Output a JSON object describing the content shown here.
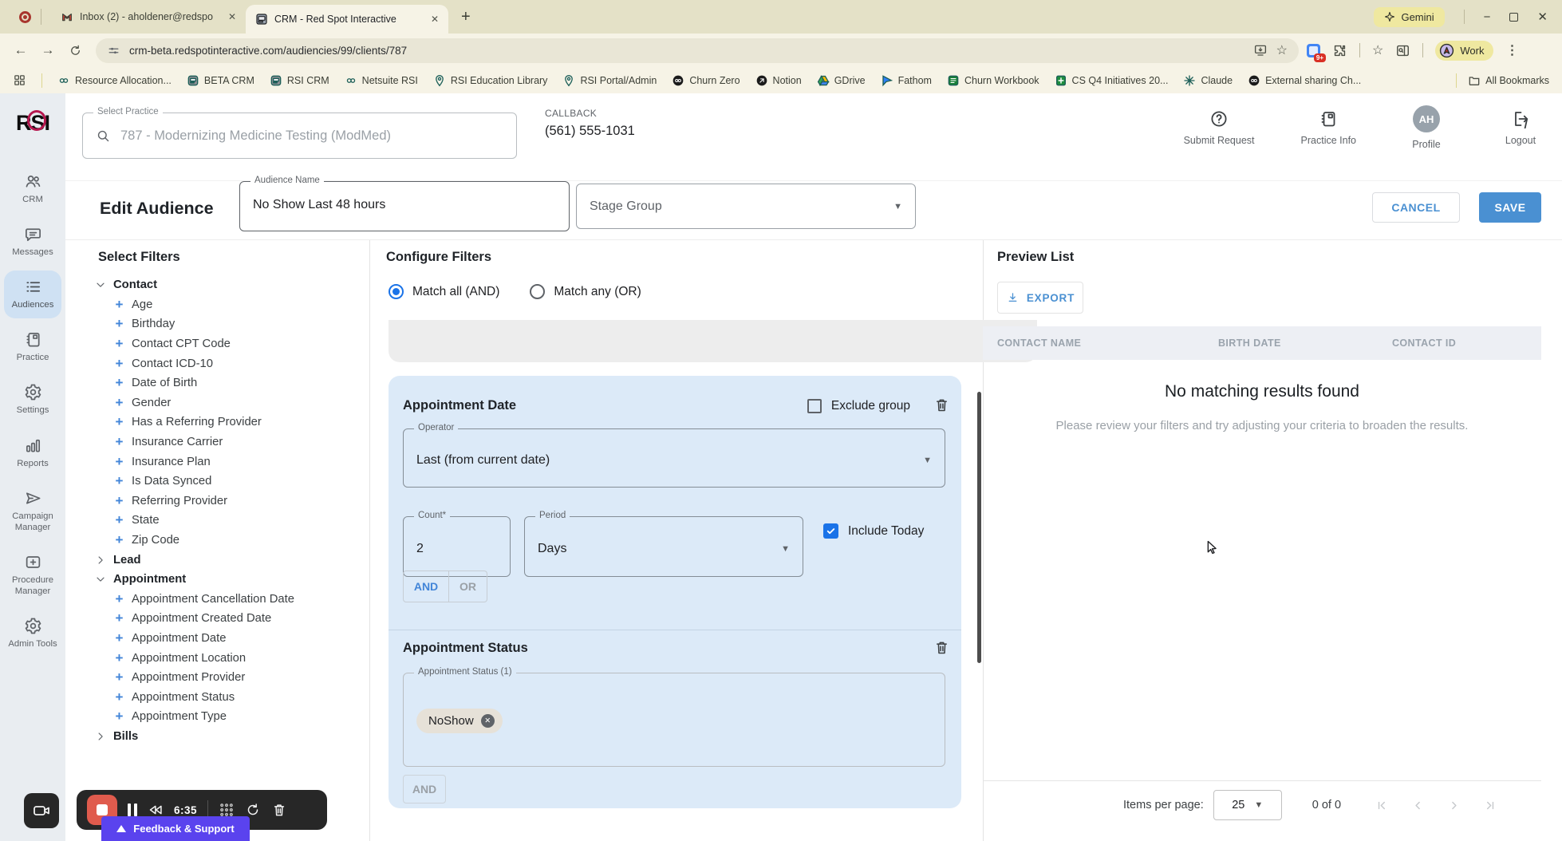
{
  "browser": {
    "tab1": "Inbox (2) - aholdener@redspo",
    "tab2": "CRM - Red Spot Interactive",
    "gemini": "Gemini",
    "url": "crm-beta.redspotinteractive.com/audiencies/99/clients/787",
    "ext_badge": "9+",
    "profile": "Work",
    "all_bookmarks": "All Bookmarks",
    "bookmarks": [
      {
        "label": "Resource Allocation...",
        "icon": "infinity-icon"
      },
      {
        "label": "BETA CRM",
        "icon": "rsi-icon"
      },
      {
        "label": "RSI CRM",
        "icon": "rsi-icon"
      },
      {
        "label": "Netsuite RSI",
        "icon": "infinity-icon"
      },
      {
        "label": "RSI Education Library",
        "icon": "map-pin-icon"
      },
      {
        "label": "RSI Portal/Admin",
        "icon": "map-pin-icon"
      },
      {
        "label": "Churn Zero",
        "icon": "infinity-badge-icon"
      },
      {
        "label": "Notion",
        "icon": "globe-arrow-icon"
      },
      {
        "label": "GDrive",
        "icon": "gdrive-icon"
      },
      {
        "label": "Fathom",
        "icon": "fathom-icon"
      },
      {
        "label": "Churn Workbook",
        "icon": "workbook-icon"
      },
      {
        "label": "CS Q4 Initiatives 20...",
        "icon": "sheets-plus-icon"
      },
      {
        "label": "Claude",
        "icon": "claude-icon"
      },
      {
        "label": "External sharing Ch...",
        "icon": "infinity-badge-icon"
      }
    ]
  },
  "header": {
    "logo": "RSI",
    "select_practice_label": "Select Practice",
    "select_practice_placeholder": "787 - Modernizing Medicine Testing (ModMed)",
    "callback_label": "CALLBACK",
    "callback_number": "(561) 555-1031",
    "actions": [
      {
        "label": "Submit Request",
        "icon": "question-circle-icon"
      },
      {
        "label": "Practice Info",
        "icon": "notebook-icon"
      },
      {
        "label": "Profile",
        "icon": "avatar",
        "initials": "AH"
      },
      {
        "label": "Logout",
        "icon": "logout-icon"
      }
    ]
  },
  "sidebar": {
    "items": [
      {
        "label": "CRM",
        "icon": "people-icon",
        "active": false
      },
      {
        "label": "Messages",
        "icon": "chat-icon",
        "active": false
      },
      {
        "label": "Audiences",
        "icon": "list-icon",
        "active": true
      },
      {
        "label": "Practice",
        "icon": "notebook-icon",
        "active": false
      },
      {
        "label": "Settings",
        "icon": "gear-icon",
        "active": false
      },
      {
        "label": "Reports",
        "icon": "bar-chart-icon",
        "active": false
      },
      {
        "label": "Campaign Manager",
        "icon": "send-icon",
        "active": false
      },
      {
        "label": "Procedure Manager",
        "icon": "medical-box-icon",
        "active": false
      },
      {
        "label": "Admin Tools",
        "icon": "gear-icon",
        "active": false
      }
    ]
  },
  "audience_bar": {
    "title": "Edit Audience",
    "name_label": "Audience Name",
    "name_value": "No Show Last 48 hours",
    "stage_group_placeholder": "Stage Group",
    "cancel": "CANCEL",
    "save": "SAVE"
  },
  "filters": {
    "title": "Select Filters",
    "tree": [
      {
        "type": "group",
        "label": "Contact",
        "expanded": true
      },
      {
        "type": "item",
        "label": "Age"
      },
      {
        "type": "item",
        "label": "Birthday"
      },
      {
        "type": "item",
        "label": "Contact CPT Code"
      },
      {
        "type": "item",
        "label": "Contact ICD-10"
      },
      {
        "type": "item",
        "label": "Date of Birth"
      },
      {
        "type": "item",
        "label": "Gender"
      },
      {
        "type": "item",
        "label": "Has a Referring Provider"
      },
      {
        "type": "item",
        "label": "Insurance Carrier"
      },
      {
        "type": "item",
        "label": "Insurance Plan"
      },
      {
        "type": "item",
        "label": "Is Data Synced"
      },
      {
        "type": "item",
        "label": "Referring Provider"
      },
      {
        "type": "item",
        "label": "State"
      },
      {
        "type": "item",
        "label": "Zip Code"
      },
      {
        "type": "group",
        "label": "Lead",
        "expanded": false
      },
      {
        "type": "group",
        "label": "Appointment",
        "expanded": true
      },
      {
        "type": "item",
        "label": "Appointment Cancellation Date"
      },
      {
        "type": "item",
        "label": "Appointment Created Date"
      },
      {
        "type": "item",
        "label": "Appointment Date"
      },
      {
        "type": "item",
        "label": "Appointment Location"
      },
      {
        "type": "item",
        "label": "Appointment Provider"
      },
      {
        "type": "item",
        "label": "Appointment Status"
      },
      {
        "type": "item",
        "label": "Appointment Type"
      },
      {
        "type": "group",
        "label": "Bills",
        "expanded": false
      }
    ]
  },
  "configure": {
    "title": "Configure Filters",
    "match_all": "Match all (AND)",
    "match_any": "Match any (OR)",
    "date_group": {
      "title": "Appointment Date",
      "exclude_label": "Exclude group",
      "operator_label": "Operator",
      "operator_value": "Last (from current date)",
      "count_label": "Count*",
      "count_value": "2",
      "period_label": "Period",
      "period_value": "Days",
      "include_today": "Include Today",
      "and": "AND",
      "or": "OR"
    },
    "status_group": {
      "title": "Appointment Status",
      "field_label": "Appointment Status (1)",
      "chip": "NoShow",
      "and": "AND"
    }
  },
  "preview": {
    "title": "Preview List",
    "export": "EXPORT",
    "columns": [
      "CONTACT NAME",
      "BIRTH DATE",
      "CONTACT ID"
    ],
    "empty_title": "No matching results found",
    "empty_message": "Please review your filters and try adjusting your criteria to broaden the results.",
    "items_per_page_label": "Items per page:",
    "page_size": "25",
    "range": "0 of 0"
  },
  "recorder": {
    "time": "6:35"
  },
  "feedback": {
    "label": "Feedback & Support"
  },
  "colors": {
    "accent_blue": "#4a90d2",
    "radio_blue": "#1a73e8",
    "card_blue": "#dceaf8",
    "sidebar_bg": "#e9edf1",
    "chrome_bg": "#e4e1c7",
    "toolbar_bg": "#f6f3e6",
    "highlight_yellow": "#efe8a0",
    "feedback_purple": "#5a43ee",
    "record_red": "#e05b4d",
    "logo_ring": "#b5174e"
  }
}
